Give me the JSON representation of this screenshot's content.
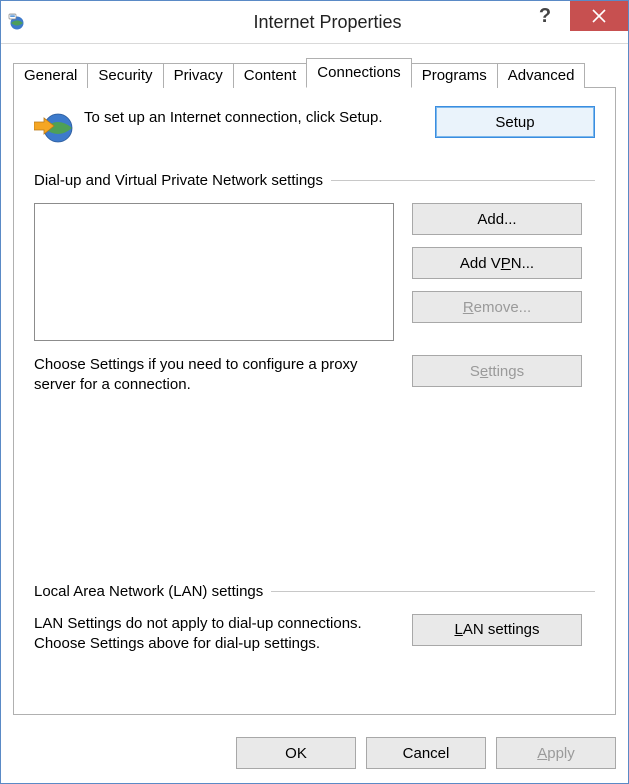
{
  "window": {
    "title": "Internet Properties"
  },
  "tabs": {
    "general": "General",
    "security": "Security",
    "privacy": "Privacy",
    "content": "Content",
    "connections": "Connections",
    "programs": "Programs",
    "advanced": "Advanced",
    "active": "connections"
  },
  "intro": {
    "text": "To set up an Internet connection, click Setup.",
    "setup_button": "Setup"
  },
  "dialup": {
    "group_label": "Dial-up and Virtual Private Network settings",
    "add_button": "Add...",
    "addvpn_prefix": "Add V",
    "addvpn_u": "P",
    "addvpn_suffix": "N...",
    "remove_prefix": "",
    "remove_u": "R",
    "remove_suffix": "emove...",
    "settings_prefix": "S",
    "settings_u": "e",
    "settings_suffix": "ttings",
    "proxy_text": "Choose Settings if you need to configure a proxy server for a connection."
  },
  "lan": {
    "group_label": "Local Area Network (LAN) settings",
    "text": "LAN Settings do not apply to dial-up connections. Choose Settings above for dial-up settings.",
    "button_prefix": "",
    "button_u": "L",
    "button_suffix": "AN settings"
  },
  "footer": {
    "ok": "OK",
    "cancel": "Cancel",
    "apply_prefix": "",
    "apply_u": "A",
    "apply_suffix": "pply"
  }
}
